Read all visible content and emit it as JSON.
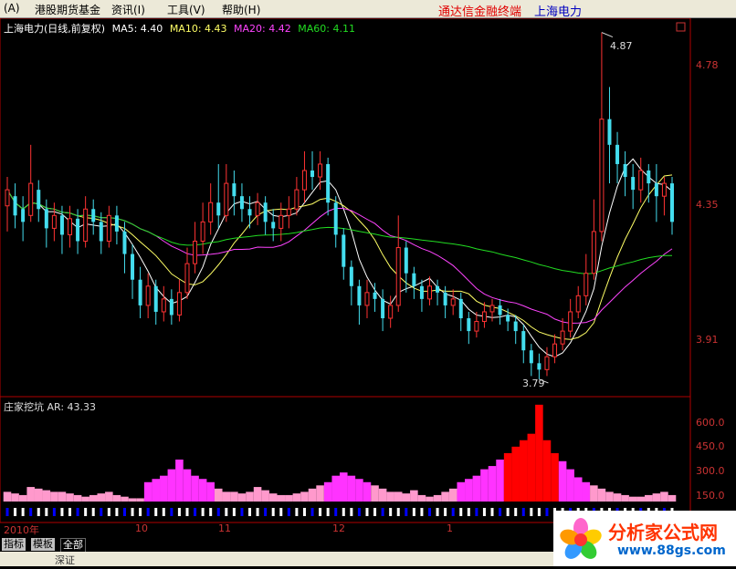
{
  "menubar": {
    "items": [
      "(A)",
      "港股期货基金",
      "资讯(I)",
      "工具(V)",
      "帮助(H)"
    ],
    "app_title": "通达信金融终端",
    "stock_title": "上海电力",
    "title_color": "#e00000",
    "stock_color": "#0000c0"
  },
  "legend": {
    "stock": "上海电力(日线,前复权)",
    "ma5": "MA5: 4.40",
    "ma10": "MA10: 4.43",
    "ma20": "MA20: 4.42",
    "ma60": "MA60: 4.11",
    "ma5_color": "#ffffff",
    "ma10_color": "#ffff66",
    "ma20_color": "#ff44ff",
    "ma60_color": "#22dd22"
  },
  "price_axis": [
    "4.78",
    "4.35",
    "3.91"
  ],
  "price_annotations": {
    "high": "4.87",
    "low": "3.79"
  },
  "indicator": {
    "name": "庄家挖坑",
    "value": "AR: 43.33",
    "axis": [
      "600.0",
      "450.0",
      "300.0",
      "150.0"
    ]
  },
  "dates": [
    "2010年",
    "10",
    "11",
    "12",
    "1"
  ],
  "tabs": [
    "指标",
    "模板",
    "全部"
  ],
  "logo": {
    "title": "分析家公式网",
    "url": "www.88gs.com"
  },
  "status": {
    "text": "深证"
  },
  "chart_data": {
    "type": "candlestick",
    "ylim": [
      3.75,
      4.9
    ],
    "candles": [
      [
        4.33,
        4.38,
        4.25,
        4.42
      ],
      [
        4.36,
        4.3,
        4.26,
        4.4
      ],
      [
        4.32,
        4.28,
        4.22,
        4.36
      ],
      [
        4.3,
        4.4,
        4.28,
        4.52
      ],
      [
        4.38,
        4.32,
        4.28,
        4.41
      ],
      [
        4.32,
        4.26,
        4.2,
        4.35
      ],
      [
        4.26,
        4.3,
        4.22,
        4.34
      ],
      [
        4.3,
        4.24,
        4.18,
        4.33
      ],
      [
        4.24,
        4.29,
        4.2,
        4.33
      ],
      [
        4.29,
        4.22,
        4.18,
        4.32
      ],
      [
        4.22,
        4.32,
        4.2,
        4.36
      ],
      [
        4.32,
        4.28,
        4.24,
        4.35
      ],
      [
        4.28,
        4.22,
        4.18,
        4.31
      ],
      [
        4.22,
        4.3,
        4.2,
        4.33
      ],
      [
        4.3,
        4.25,
        4.21,
        4.33
      ],
      [
        4.25,
        4.18,
        4.12,
        4.28
      ],
      [
        4.18,
        4.1,
        4.04,
        4.21
      ],
      [
        4.1,
        4.02,
        3.98,
        4.14
      ],
      [
        4.02,
        4.08,
        3.98,
        4.12
      ],
      [
        4.08,
        4.0,
        3.96,
        4.1
      ],
      [
        4.0,
        4.04,
        3.97,
        4.08
      ],
      [
        4.04,
        3.99,
        3.96,
        4.07
      ],
      [
        3.99,
        4.06,
        3.97,
        4.1
      ],
      [
        4.06,
        4.15,
        4.04,
        4.2
      ],
      [
        4.15,
        4.22,
        4.12,
        4.28
      ],
      [
        4.22,
        4.28,
        4.18,
        4.34
      ],
      [
        4.28,
        4.34,
        4.24,
        4.4
      ],
      [
        4.34,
        4.3,
        4.26,
        4.46
      ],
      [
        4.3,
        4.4,
        4.28,
        4.46
      ],
      [
        4.4,
        4.36,
        4.3,
        4.44
      ],
      [
        4.36,
        4.32,
        4.28,
        4.4
      ],
      [
        4.32,
        4.3,
        4.26,
        4.36
      ],
      [
        4.3,
        4.34,
        4.27,
        4.37
      ],
      [
        4.34,
        4.28,
        4.24,
        4.36
      ],
      [
        4.28,
        4.26,
        4.22,
        4.32
      ],
      [
        4.26,
        4.3,
        4.22,
        4.34
      ],
      [
        4.3,
        4.32,
        4.26,
        4.36
      ],
      [
        4.32,
        4.38,
        4.3,
        4.42
      ],
      [
        4.38,
        4.44,
        4.34,
        4.5
      ],
      [
        4.44,
        4.42,
        4.38,
        4.5
      ],
      [
        4.42,
        4.46,
        4.38,
        4.5
      ],
      [
        4.46,
        4.34,
        4.3,
        4.48
      ],
      [
        4.34,
        4.24,
        4.2,
        4.36
      ],
      [
        4.24,
        4.14,
        4.1,
        4.26
      ],
      [
        4.14,
        4.08,
        4.02,
        4.16
      ],
      [
        4.08,
        4.02,
        3.96,
        4.1
      ],
      [
        4.02,
        4.06,
        3.98,
        4.1
      ],
      [
        4.06,
        4.04,
        4.0,
        4.09
      ],
      [
        4.04,
        3.98,
        3.94,
        4.07
      ],
      [
        3.98,
        4.02,
        3.95,
        4.05
      ],
      [
        4.02,
        4.2,
        4.0,
        4.3
      ],
      [
        4.2,
        4.12,
        4.06,
        4.22
      ],
      [
        4.12,
        4.08,
        4.04,
        4.14
      ],
      [
        4.08,
        4.04,
        4.0,
        4.1
      ],
      [
        4.04,
        4.08,
        4.02,
        4.11
      ],
      [
        4.08,
        4.06,
        4.02,
        4.1
      ],
      [
        4.06,
        4.02,
        3.98,
        4.08
      ],
      [
        4.02,
        4.04,
        3.99,
        4.07
      ],
      [
        4.04,
        3.98,
        3.94,
        4.06
      ],
      [
        3.98,
        3.94,
        3.9,
        4.0
      ],
      [
        3.94,
        3.97,
        3.92,
        4.0
      ],
      [
        3.97,
        4.0,
        3.95,
        4.03
      ],
      [
        4.0,
        4.02,
        3.97,
        4.04
      ],
      [
        4.02,
        3.99,
        3.96,
        4.04
      ],
      [
        3.99,
        3.97,
        3.94,
        4.01
      ],
      [
        3.97,
        3.94,
        3.9,
        3.99
      ],
      [
        3.94,
        3.88,
        3.84,
        3.96
      ],
      [
        3.88,
        3.84,
        3.8,
        3.9
      ],
      [
        3.84,
        3.82,
        3.79,
        3.87
      ],
      [
        3.82,
        3.86,
        3.8,
        3.89
      ],
      [
        3.86,
        3.9,
        3.84,
        3.93
      ],
      [
        3.9,
        3.94,
        3.88,
        3.98
      ],
      [
        3.94,
        4.0,
        3.92,
        4.04
      ],
      [
        4.0,
        4.05,
        3.98,
        4.08
      ],
      [
        4.05,
        4.12,
        4.02,
        4.18
      ],
      [
        4.12,
        4.25,
        4.1,
        4.35
      ],
      [
        4.25,
        4.6,
        4.22,
        4.87
      ],
      [
        4.6,
        4.52,
        4.4,
        4.7
      ],
      [
        4.52,
        4.46,
        4.4,
        4.56
      ],
      [
        4.46,
        4.42,
        4.36,
        4.5
      ],
      [
        4.42,
        4.38,
        4.32,
        4.46
      ],
      [
        4.38,
        4.44,
        4.34,
        4.48
      ],
      [
        4.44,
        4.4,
        4.34,
        4.46
      ],
      [
        4.4,
        4.36,
        4.28,
        4.46
      ],
      [
        4.36,
        4.4,
        4.3,
        4.42
      ],
      [
        4.4,
        4.28,
        4.24,
        4.42
      ]
    ],
    "ar": [
      60,
      50,
      40,
      90,
      80,
      70,
      60,
      60,
      50,
      40,
      30,
      40,
      50,
      60,
      40,
      30,
      20,
      20,
      120,
      140,
      160,
      200,
      260,
      200,
      160,
      140,
      120,
      80,
      60,
      60,
      50,
      60,
      90,
      70,
      50,
      40,
      40,
      50,
      60,
      80,
      100,
      120,
      160,
      180,
      160,
      140,
      120,
      100,
      80,
      60,
      60,
      50,
      70,
      40,
      30,
      40,
      60,
      80,
      120,
      140,
      160,
      200,
      220,
      260,
      300,
      340,
      380,
      420,
      600,
      380,
      300,
      250,
      200,
      150,
      120,
      100,
      80,
      60,
      50,
      40,
      30,
      30,
      40,
      50,
      60,
      40
    ]
  }
}
